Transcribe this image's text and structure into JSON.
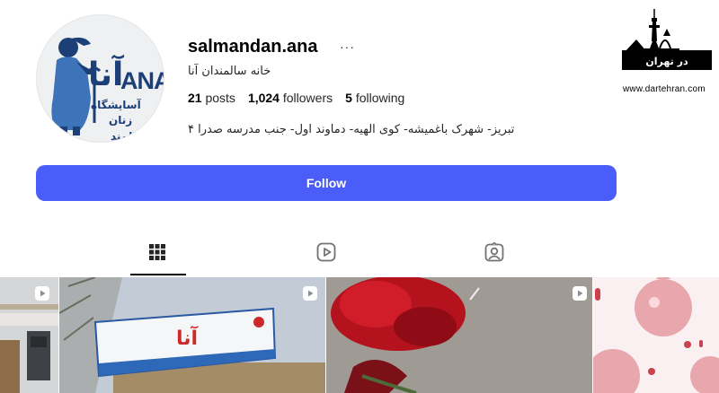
{
  "profile": {
    "username": "salmandan.ana",
    "more_icon": "···",
    "full_name": "خانه سالمندان آنا",
    "bio": "تبریز- شهرک باغمیشه- کوی الهیه- دماوند اول- جنب مدرسه صدرا ۴",
    "avatar": {
      "logo_latin": "ANA",
      "logo_big": "آنا",
      "line1": "آسایشگاه",
      "line2": "زنان",
      "line3": "سالمند"
    }
  },
  "stats": {
    "posts_count": "21",
    "posts_label": "posts",
    "followers_count": "1,024",
    "followers_label": "followers",
    "following_count": "5",
    "following_label": "following"
  },
  "actions": {
    "follow_label": "Follow",
    "follow_color": "#4a5df9"
  },
  "tabs": [
    {
      "name": "posts",
      "icon": "grid-icon",
      "active": true
    },
    {
      "name": "reels",
      "icon": "reels-icon",
      "active": false
    },
    {
      "name": "tagged",
      "icon": "tagged-icon",
      "active": false
    }
  ],
  "watermark": {
    "logo_text": "در تهران",
    "domain": "www.dartehran.com"
  }
}
